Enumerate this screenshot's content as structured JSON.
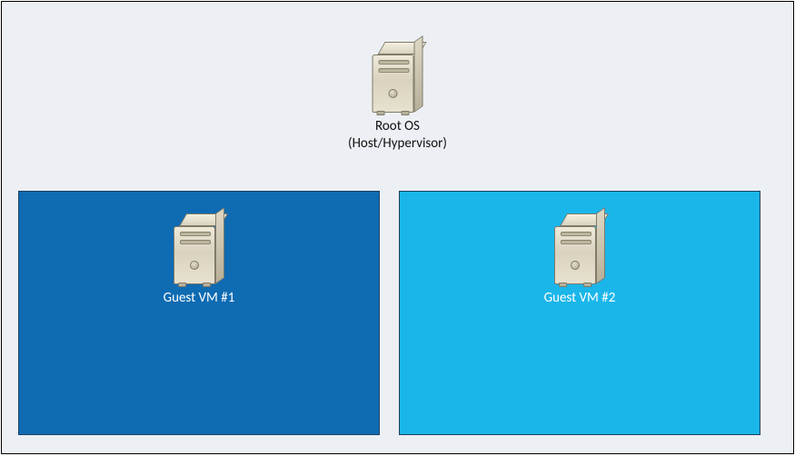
{
  "root": {
    "label_line1": "Root OS",
    "label_line2": "(Host/Hypervisor)"
  },
  "guests": [
    {
      "label": "Guest VM #1",
      "bg": "#0f6bb2",
      "border": "#20405f"
    },
    {
      "label": "Guest VM #2",
      "bg": "#1ab6ea",
      "border": "#20405f"
    }
  ]
}
